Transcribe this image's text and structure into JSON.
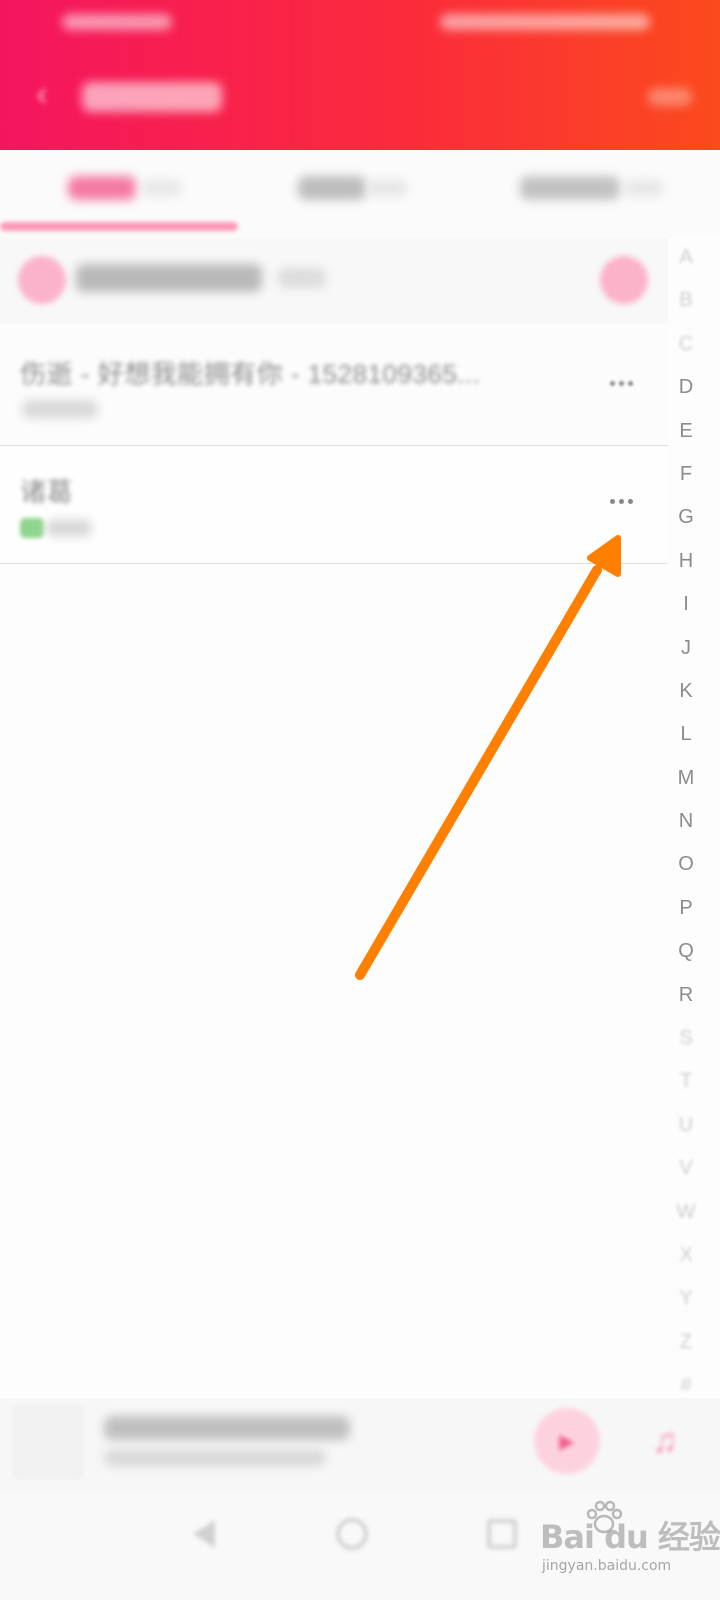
{
  "list": {
    "items": [
      {
        "title": "伤逝 - 好想我能拥有你 - 1528109365...",
        "more_label": "•••"
      },
      {
        "title": "诸葛",
        "more_label": "•••"
      }
    ]
  },
  "index_bar": {
    "letters": [
      "A",
      "B",
      "C",
      "D",
      "E",
      "F",
      "G",
      "H",
      "I",
      "J",
      "K",
      "L",
      "M",
      "N",
      "O",
      "P",
      "Q",
      "R",
      "S",
      "T",
      "U",
      "V",
      "W",
      "X",
      "Y",
      "Z",
      "#"
    ]
  },
  "watermark": {
    "logo": "Bai du 经验",
    "url": "jingyan.baidu.com"
  },
  "colors": {
    "header_gradient_start": "#f4155f",
    "header_gradient_end": "#fb4a1d",
    "accent_pink": "#f47aa2",
    "annotation_arrow": "#ff7f00"
  }
}
